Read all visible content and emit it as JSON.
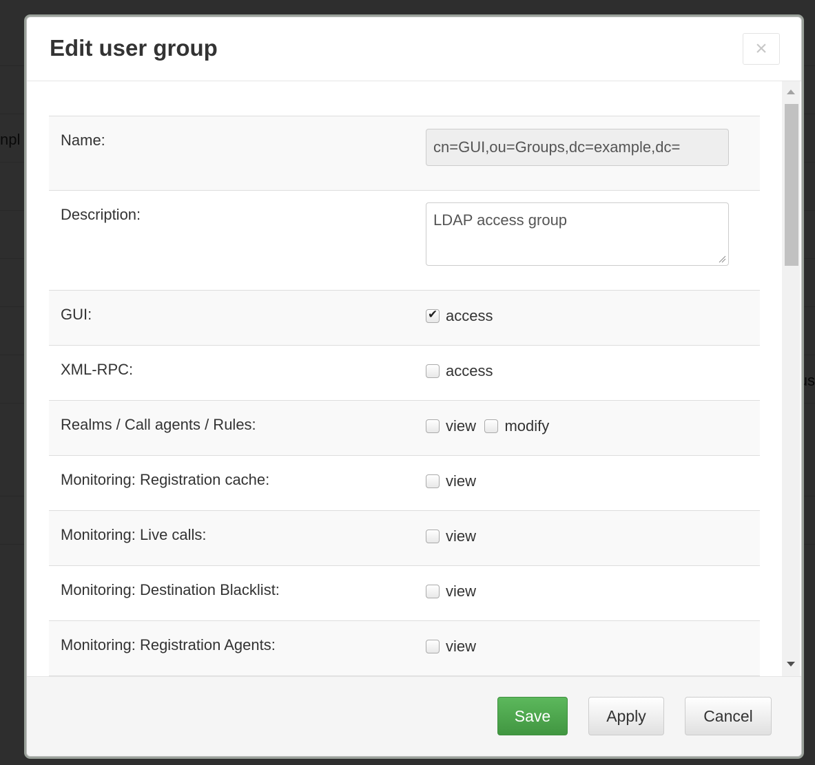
{
  "background": {
    "left_fragment": "npl",
    "right_fragment": "us"
  },
  "modal": {
    "title": "Edit user group",
    "close_label": "×"
  },
  "fields": {
    "name": {
      "label": "Name:",
      "value": "cn=GUI,ou=Groups,dc=example,dc="
    },
    "description": {
      "label": "Description:",
      "value": "LDAP access group"
    }
  },
  "permissions": [
    {
      "label": "GUI:",
      "options": [
        {
          "label": "access",
          "checked": true
        }
      ]
    },
    {
      "label": "XML-RPC:",
      "options": [
        {
          "label": "access",
          "checked": false
        }
      ]
    },
    {
      "label": "Realms / Call agents / Rules:",
      "options": [
        {
          "label": "view",
          "checked": false
        },
        {
          "label": "modify",
          "checked": false
        }
      ]
    },
    {
      "label": "Monitoring: Registration cache:",
      "options": [
        {
          "label": "view",
          "checked": false
        }
      ]
    },
    {
      "label": "Monitoring: Live calls:",
      "options": [
        {
          "label": "view",
          "checked": false
        }
      ]
    },
    {
      "label": "Monitoring: Destination Blacklist:",
      "options": [
        {
          "label": "view",
          "checked": false
        }
      ]
    },
    {
      "label": "Monitoring: Registration Agents:",
      "options": [
        {
          "label": "view",
          "checked": false
        }
      ]
    }
  ],
  "footer": {
    "save_label": "Save",
    "apply_label": "Apply",
    "cancel_label": "Cancel"
  },
  "colors": {
    "save_button": "#5cb85c",
    "row_stripe": "#f9f9f9",
    "footer_bg": "#f5f5f5"
  },
  "icons": {
    "close": "close-icon",
    "checkbox_checked": "checkmark-icon"
  }
}
